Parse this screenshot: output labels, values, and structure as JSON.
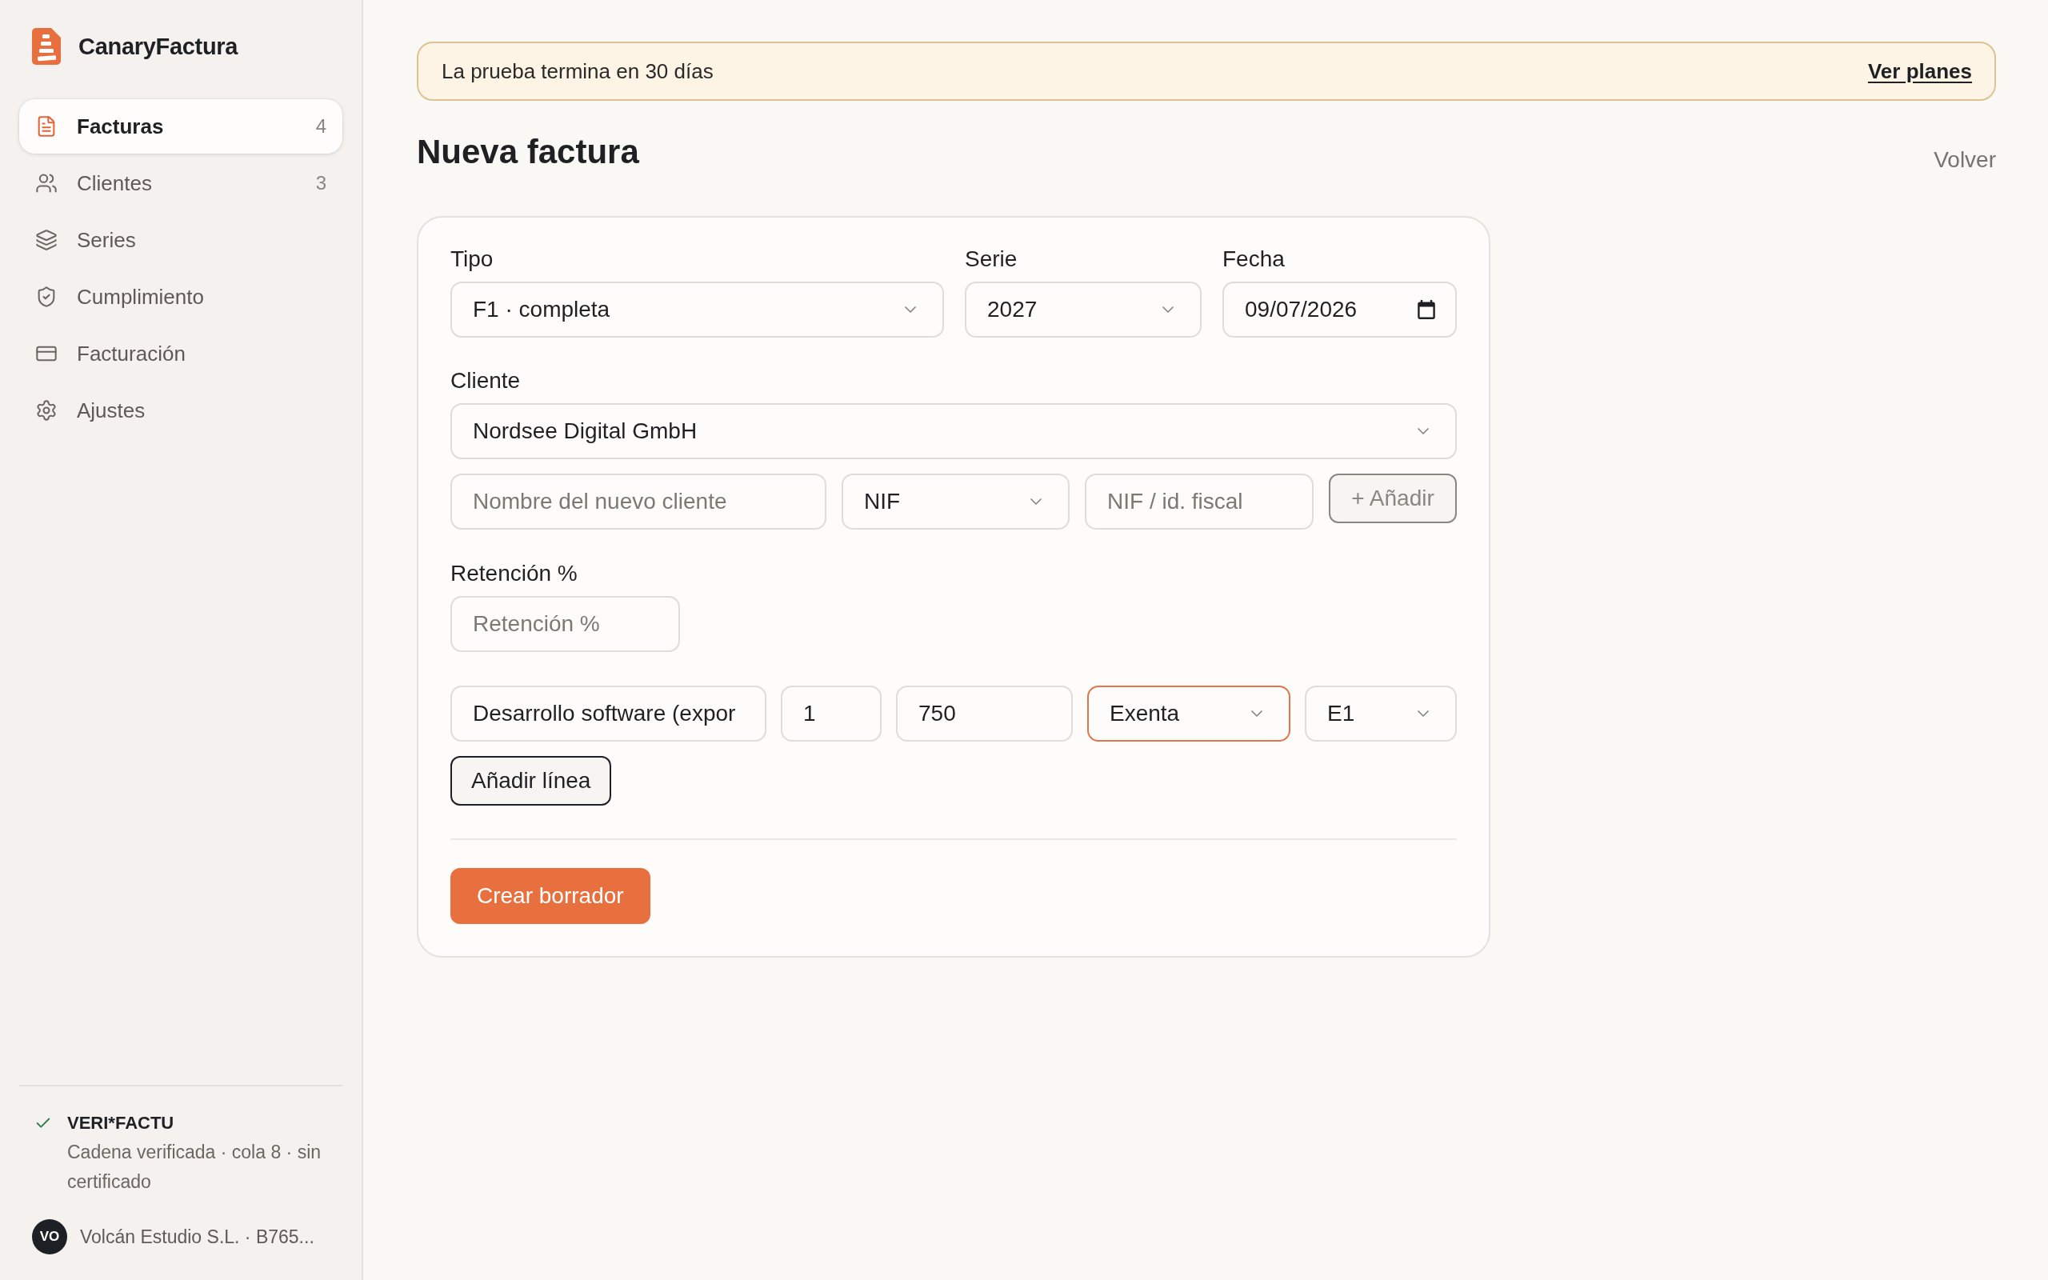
{
  "sidebar": {
    "brand": "CanaryFactura",
    "nav": [
      {
        "label": "Facturas",
        "count": "4",
        "selected": true
      },
      {
        "label": "Clientes",
        "count": "3",
        "selected": false
      },
      {
        "label": "Series",
        "selected": false
      },
      {
        "label": "Cumplimiento",
        "selected": false
      },
      {
        "label": "Facturación",
        "selected": false
      },
      {
        "label": "Ajustes",
        "selected": false
      }
    ],
    "status": {
      "title": "VERI*FACTU",
      "detail": "Cadena verificada · cola 8 · sin certificado",
      "verified": true
    },
    "account": {
      "initials": "VO",
      "name": "Volcán Estudio S.L. · B765..."
    }
  },
  "banner": {
    "text": "La prueba termina en 30 días",
    "link": "Ver planes"
  },
  "page": {
    "title": "Nueva factura",
    "back": "Volver"
  },
  "form": {
    "top_fields": [
      {
        "label": "Tipo",
        "kind": "select",
        "value": "F1 · completa"
      },
      {
        "label": "Serie",
        "kind": "select",
        "value": "2027"
      },
      {
        "label": "Fecha",
        "kind": "date",
        "value": "09/07/2026"
      }
    ],
    "client": {
      "label": "Cliente",
      "value": "Nordsee Digital GmbH"
    },
    "new_client": [
      {
        "kind": "input",
        "placeholder": "Nombre del nuevo cliente"
      },
      {
        "kind": "select",
        "value": "NIF"
      },
      {
        "kind": "input",
        "placeholder": "NIF / id. fiscal"
      }
    ],
    "add_client_button": {
      "label": "+ Añadir",
      "disabled": true
    },
    "retention": {
      "label": "Retención %",
      "placeholder": "Retención %"
    },
    "lines": [
      {
        "cells": [
          {
            "kind": "input",
            "value": "Desarrollo software (expor",
            "focused": false
          },
          {
            "kind": "input",
            "value": "1",
            "focused": false
          },
          {
            "kind": "input",
            "value": "750",
            "focused": false
          },
          {
            "kind": "select",
            "value": "Exenta",
            "focused": true
          },
          {
            "kind": "select",
            "value": "E1",
            "focused": false
          }
        ]
      }
    ],
    "add_line_button": "Añadir línea",
    "submit_button": "Crear borrador"
  }
}
